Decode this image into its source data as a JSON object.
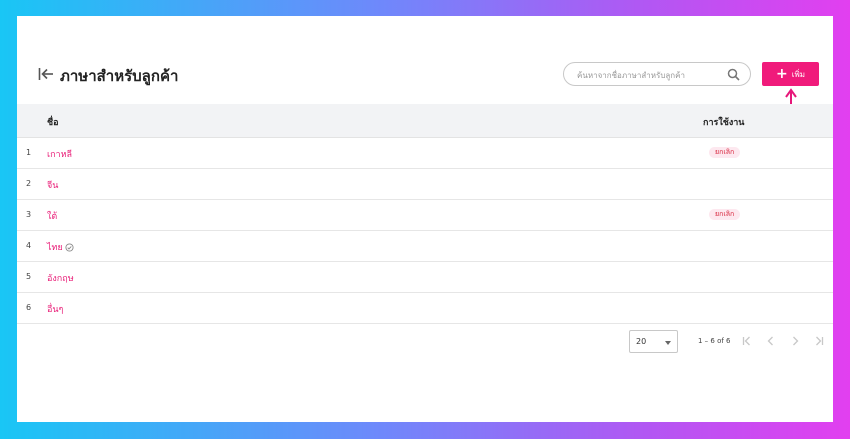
{
  "header": {
    "title": "ภาษาสำหรับลูกค้า",
    "search_placeholder": "ค้นหาจากชื่อภาษาสำหรับลูกค้า",
    "add_label": "เพิ่ม",
    "add_symbol": "+"
  },
  "table": {
    "columns": {
      "name": "ชื่อ",
      "usage": "การใช้งาน"
    },
    "rows": [
      {
        "index": "1",
        "name": "เกาหลี",
        "status": "ยกเลิก"
      },
      {
        "index": "2",
        "name": "จีน",
        "status": ""
      },
      {
        "index": "3",
        "name": "ใต้",
        "status": "ยกเลิก"
      },
      {
        "index": "4",
        "name": "ไทย",
        "status": ""
      },
      {
        "index": "5",
        "name": "อังกฤษ",
        "status": ""
      },
      {
        "index": "6",
        "name": "อื่นๆ",
        "status": ""
      }
    ]
  },
  "pagination": {
    "page_size": "20",
    "range": "1 – 6 of 6"
  },
  "colors": {
    "accent": "#f01b7b",
    "link": "#e91e78",
    "badge_text": "#d7263d",
    "badge_bg": "#fde8ef"
  },
  "icons": {
    "back": "collapse-left-icon",
    "search": "search-icon",
    "default": "check-circle-icon",
    "arrow": "arrow-up-icon"
  }
}
